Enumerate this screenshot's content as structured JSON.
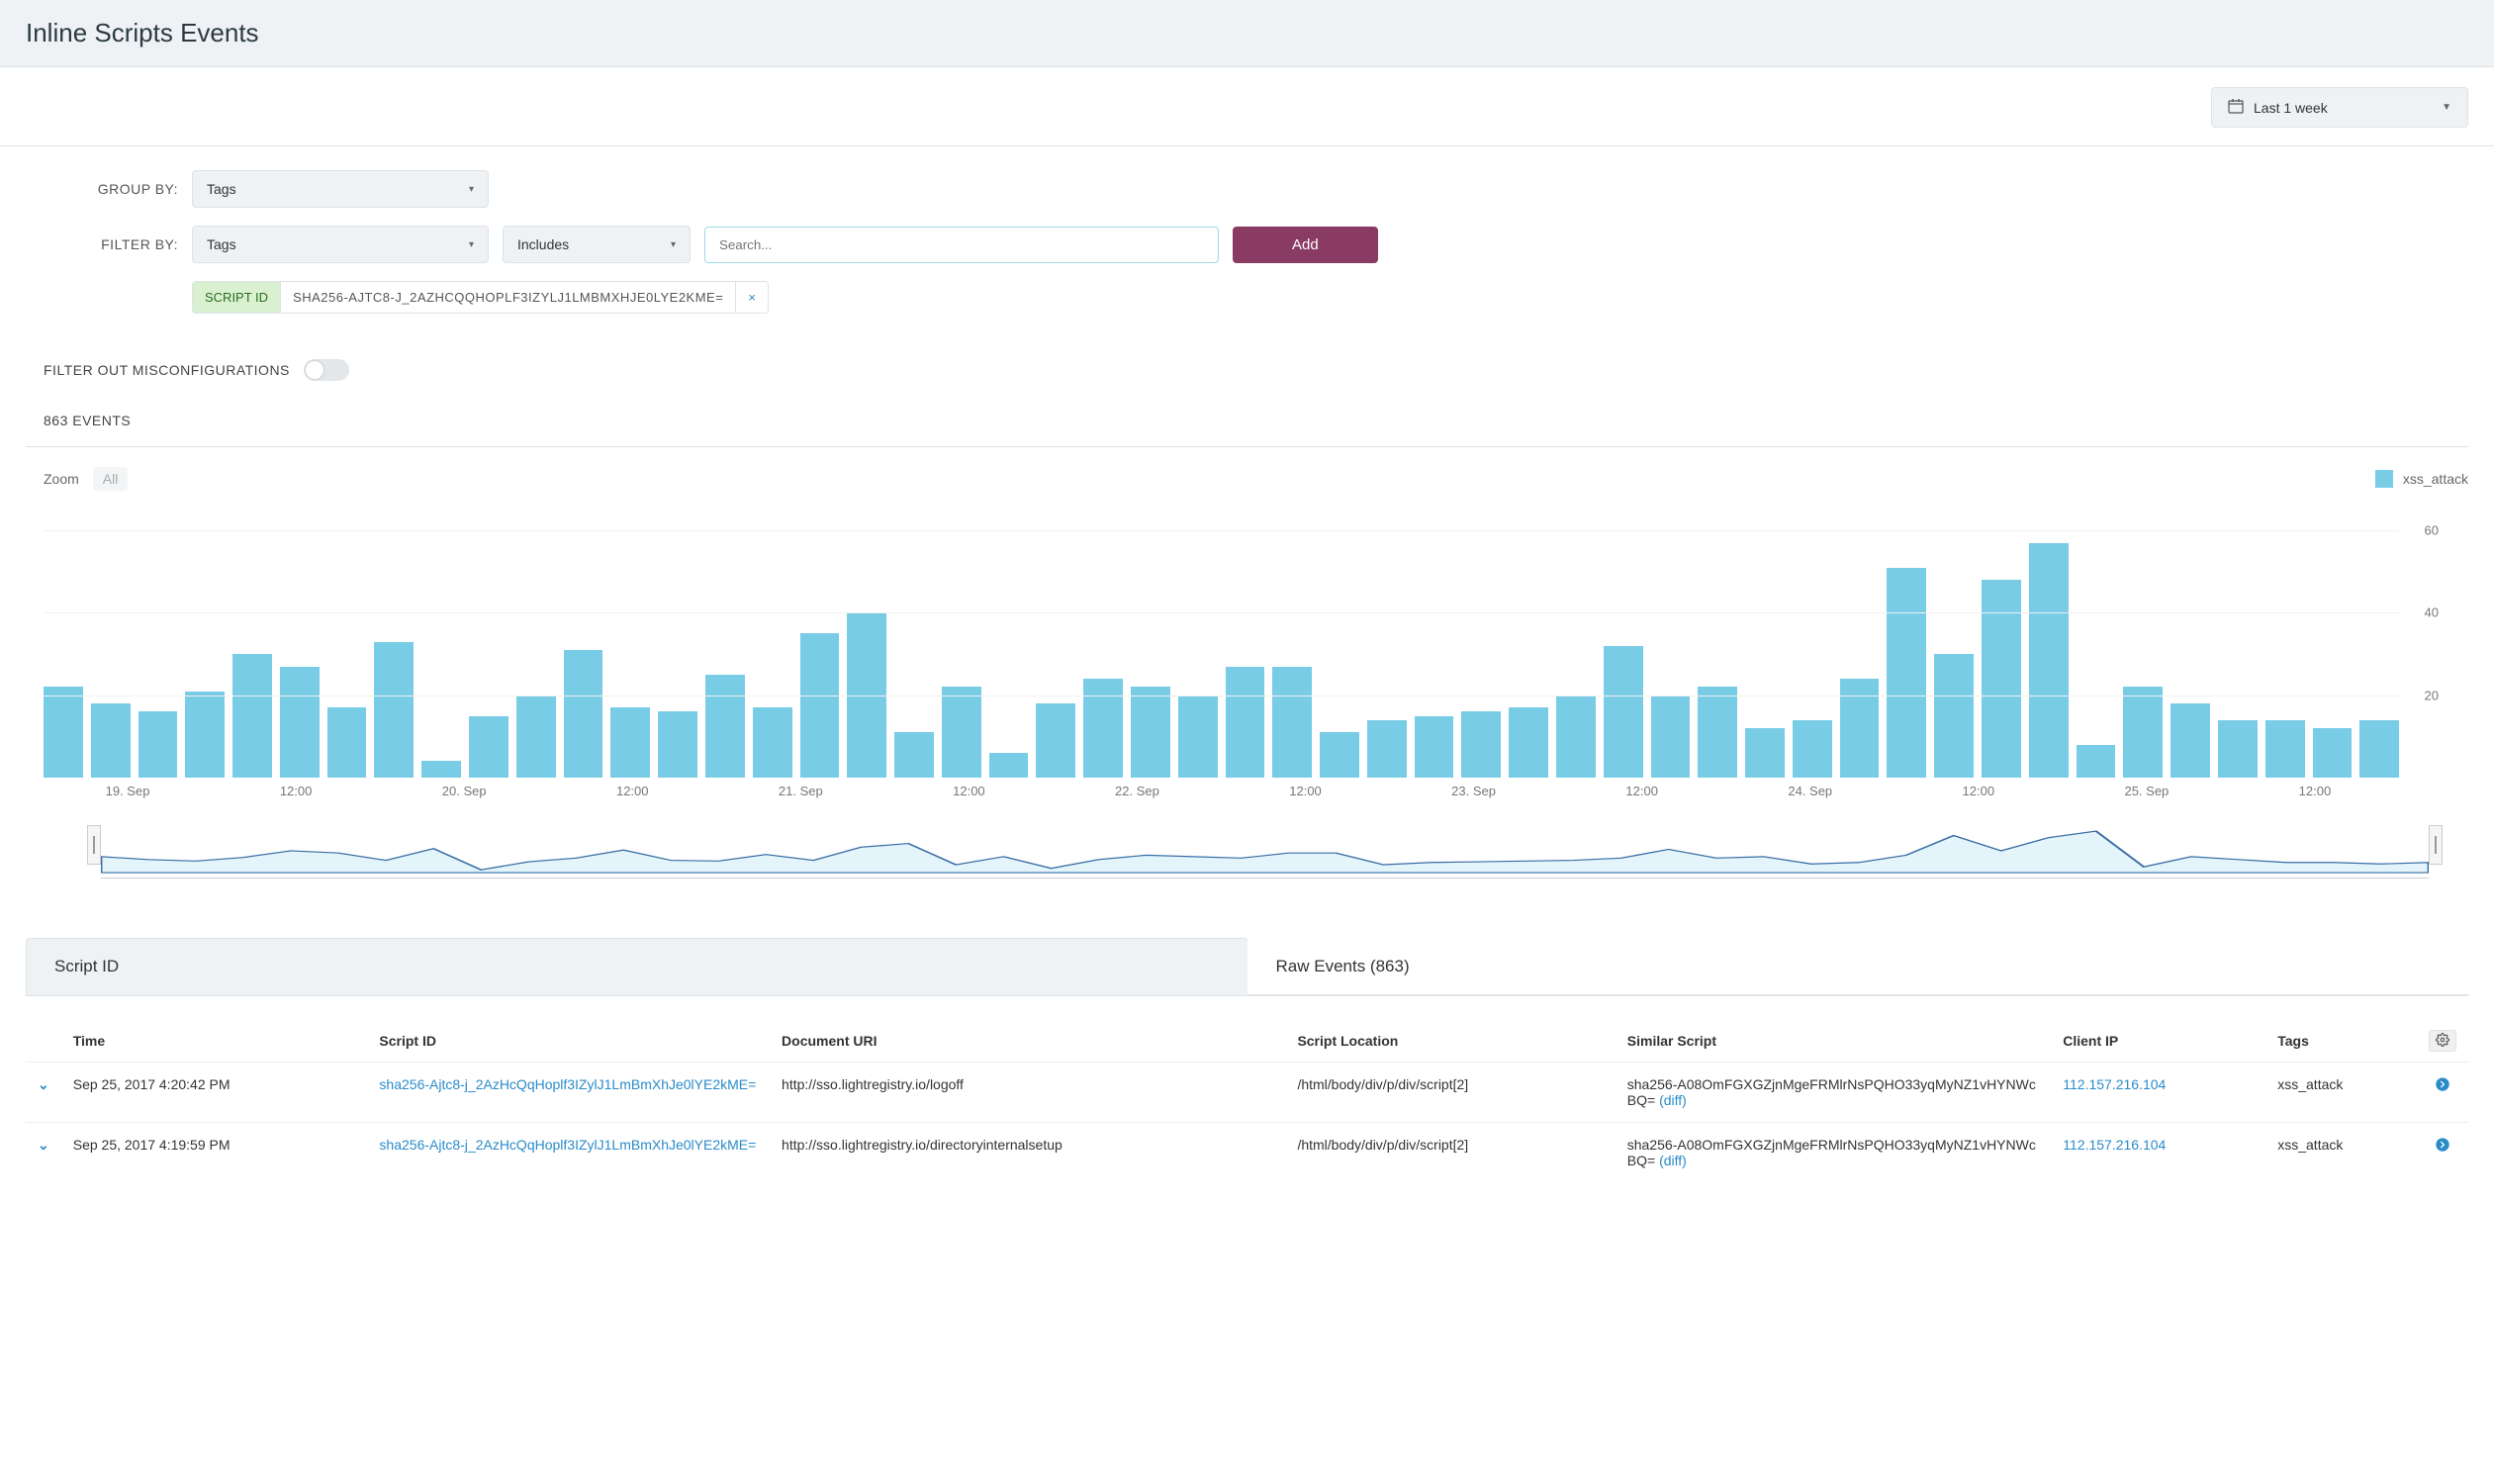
{
  "header": {
    "title": "Inline Scripts Events"
  },
  "date_range": {
    "label": "Last 1 week"
  },
  "group_by": {
    "label": "GROUP BY:",
    "value": "Tags"
  },
  "filter_by": {
    "label": "FILTER BY:",
    "field": "Tags",
    "operator": "Includes",
    "search_placeholder": "Search...",
    "add_label": "Add",
    "chip": {
      "key": "SCRIPT ID",
      "value": "SHA256-AJTC8-J_2AZHCQQHOPLF3IZYLJ1LMBMXHJE0LYE2KME="
    }
  },
  "misconfig": {
    "label": "FILTER OUT MISCONFIGURATIONS",
    "on": false
  },
  "events_count": {
    "label": "863 EVENTS"
  },
  "chart_controls": {
    "zoom_label": "Zoom",
    "zoom_all": "All"
  },
  "legend": {
    "name": "xss_attack",
    "color": "#79cce5"
  },
  "chart_data": {
    "type": "bar",
    "title": "",
    "xlabel": "",
    "ylabel": "",
    "ylim": [
      0,
      60
    ],
    "yticks": [
      20,
      40,
      60
    ],
    "x_ticks": [
      "19. Sep",
      "12:00",
      "20. Sep",
      "12:00",
      "21. Sep",
      "12:00",
      "22. Sep",
      "12:00",
      "23. Sep",
      "12:00",
      "24. Sep",
      "12:00",
      "25. Sep",
      "12:00"
    ],
    "series": [
      {
        "name": "xss_attack",
        "values": [
          22,
          18,
          16,
          21,
          30,
          27,
          17,
          33,
          4,
          15,
          20,
          31,
          17,
          16,
          25,
          17,
          35,
          40,
          11,
          22,
          6,
          18,
          24,
          22,
          20,
          27,
          27,
          11,
          14,
          15,
          16,
          17,
          20,
          32,
          20,
          22,
          12,
          14,
          24,
          51,
          30,
          48,
          57,
          8,
          22,
          18,
          14,
          14,
          12,
          14
        ]
      }
    ],
    "nav_x_ticks": [
      "19. Sep",
      "20. Sep",
      "21. Sep",
      "22. Sep",
      "23. Sep",
      "24. Sep",
      "25. Sep"
    ]
  },
  "tabs": {
    "script_id": "Script ID",
    "raw_events": "Raw Events (863)"
  },
  "table": {
    "columns": {
      "time": "Time",
      "script_id": "Script ID",
      "document_uri": "Document URI",
      "script_location": "Script Location",
      "similar_script": "Similar Script",
      "client_ip": "Client IP",
      "tags": "Tags"
    },
    "rows": [
      {
        "time": "Sep 25, 2017 4:20:42 PM",
        "script_id": "sha256-Ajtc8-j_2AzHcQqHoplf3IZylJ1LmBmXhJe0lYE2kME=",
        "document_uri": "http://sso.lightregistry.io/logoff",
        "script_location": "/html/body/div/p/div/script[2]",
        "similar_script": "sha256-A08OmFGXGZjnMgeFRMlrNsPQHO33yqMyNZ1vHYNWcBQ=",
        "diff_label": "(diff)",
        "client_ip": "112.157.216.104",
        "tags": "xss_attack"
      },
      {
        "time": "Sep 25, 2017 4:19:59 PM",
        "script_id": "sha256-Ajtc8-j_2AzHcQqHoplf3IZylJ1LmBmXhJe0lYE2kME=",
        "document_uri": "http://sso.lightregistry.io/directoryinternalsetup",
        "script_location": "/html/body/div/p/div/script[2]",
        "similar_script": "sha256-A08OmFGXGZjnMgeFRMlrNsPQHO33yqMyNZ1vHYNWcBQ=",
        "diff_label": "(diff)",
        "client_ip": "112.157.216.104",
        "tags": "xss_attack"
      }
    ]
  }
}
